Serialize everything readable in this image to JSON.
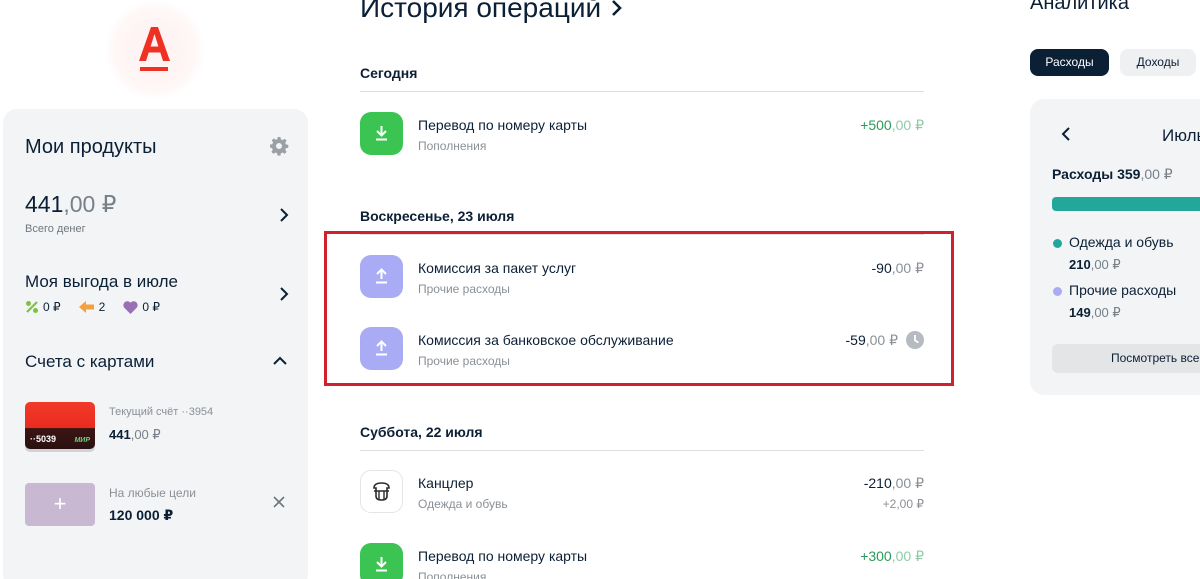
{
  "sidebar": {
    "products_title": "Мои продукты",
    "total": {
      "main": "441",
      "cents": ",00 ₽",
      "label": "Всего денег"
    },
    "benefit": {
      "title": "Моя выгода в июле",
      "percent_value": "0 ₽",
      "arrows_value": "2",
      "heart_value": "0 ₽"
    },
    "accounts_title": "Счета с картами",
    "account": {
      "card_number": "··5039",
      "card_system": "МИР",
      "name": "Текущий счёт ··3954",
      "balance_main": "441",
      "balance_cents": ",00 ₽"
    },
    "goal": {
      "plus": "+",
      "name": "На любые цели",
      "value": "120 000 ₽"
    }
  },
  "history": {
    "title": "История операций",
    "days": [
      {
        "label": "Сегодня",
        "items": [
          {
            "name": "Перевод по номеру карты",
            "category": "Пополнения",
            "amount_main": "+500",
            "amount_cents": ",00 ₽"
          }
        ]
      },
      {
        "label": "Воскресенье, 23 июля",
        "items": [
          {
            "name": "Комиссия за пакет услуг",
            "category": "Прочие расходы",
            "amount_main": "-90",
            "amount_cents": ",00 ₽"
          },
          {
            "name": "Комиссия за банковское обслуживание",
            "category": "Прочие расходы",
            "amount_main": "-59",
            "amount_cents": ",00 ₽"
          }
        ]
      },
      {
        "label": "Суббота, 22 июля",
        "items": [
          {
            "name": "Канцлер",
            "category": "Одежда и обувь",
            "amount_main": "-210",
            "amount_cents": ",00 ₽",
            "sub": "+2,00 ₽"
          },
          {
            "name": "Перевод по номеру карты",
            "category": "Пополнения",
            "amount_main": "+300",
            "amount_cents": ",00 ₽"
          }
        ]
      }
    ]
  },
  "analytics": {
    "title": "Аналитика",
    "tabs": [
      "Расходы",
      "Доходы"
    ],
    "month": "Июль",
    "expenses_label": "Расходы 359",
    "expenses_cents": ",00 ₽",
    "legend": [
      {
        "name": "Одежда и обувь",
        "value_main": "210",
        "value_cents": ",00 ₽",
        "color": "#23a79b"
      },
      {
        "name": "Прочие расходы",
        "value_main": "149",
        "value_cents": ",00 ₽",
        "color": "#a9acf4"
      }
    ],
    "view_all": "Посмотреть все"
  },
  "colors": {
    "brand_red": "#ef3124",
    "income_green": "#2a9a5b",
    "highlight_border": "#d0212e"
  }
}
